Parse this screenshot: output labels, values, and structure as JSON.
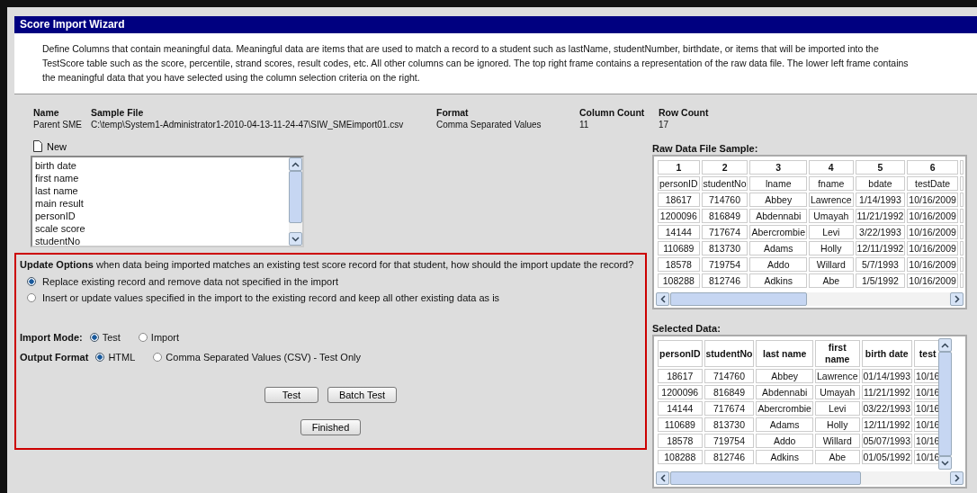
{
  "window": {
    "title": "Score Import Wizard"
  },
  "description": "Define Columns that contain meaningful data. Meaningful data are items that are used to match a record to a student such as lastName, studentNumber, birthdate, or items that will be imported into the TestScore table such as the score, percentile, strand scores, result codes, etc. All other columns can be ignored. The top right frame contains a representation of the raw data file. The lower left frame contains the meaningful data that you have selected using the column selection criteria on the right.",
  "file_info": [
    {
      "label": "Name",
      "value": "Parent SME"
    },
    {
      "label": "Sample File",
      "value": "C:\\temp\\System1-Administrator1-2010-04-13-11-24-47\\SIW_SMEimport01.csv"
    },
    {
      "label": "Format",
      "value": "Comma Separated Values"
    },
    {
      "label": "Column Count",
      "value": "11"
    },
    {
      "label": "Row Count",
      "value": "17"
    }
  ],
  "new_button": {
    "label": "New"
  },
  "field_list": {
    "items": [
      "birth date",
      "first name",
      "last name",
      "main result",
      "personID",
      "scale score",
      "studentNo"
    ]
  },
  "update_options": {
    "label": "Update Options",
    "question": "when data being imported matches an existing test score record for that student, how should the import update the record?",
    "options": [
      {
        "label": "Replace existing record and remove data not specified in the import",
        "selected": true
      },
      {
        "label": "Insert or update values specified in the import to the existing record and keep all other existing data as is",
        "selected": false
      }
    ]
  },
  "import_mode": {
    "label": "Import Mode:",
    "options": [
      {
        "label": "Test",
        "selected": true
      },
      {
        "label": "Import",
        "selected": false
      }
    ]
  },
  "output_format": {
    "label": "Output Format",
    "options": [
      {
        "label": "HTML",
        "selected": true
      },
      {
        "label": "Comma Separated Values (CSV) - Test Only",
        "selected": false
      }
    ]
  },
  "button_rows": [
    [
      "Test",
      "Batch Test"
    ],
    [
      "Finished"
    ]
  ],
  "raw_sample": {
    "title": "Raw Data File Sample:",
    "column_numbers": [
      "1",
      "2",
      "3",
      "4",
      "5",
      "6"
    ],
    "column_names": [
      "personID",
      "studentNo",
      "lname",
      "fname",
      "bdate",
      "testDate"
    ],
    "rows": [
      [
        "18617",
        "714760",
        "Abbey",
        "Lawrence",
        "1/14/1993",
        "10/16/2009"
      ],
      [
        "1200096",
        "816849",
        "Abdennabi",
        "Umayah",
        "11/21/1992",
        "10/16/2009"
      ],
      [
        "14144",
        "717674",
        "Abercrombie",
        "Levi",
        "3/22/1993",
        "10/16/2009"
      ],
      [
        "110689",
        "813730",
        "Adams",
        "Holly",
        "12/11/1992",
        "10/16/2009"
      ],
      [
        "18578",
        "719754",
        "Addo",
        "Willard",
        "5/7/1993",
        "10/16/2009"
      ],
      [
        "108288",
        "812746",
        "Adkins",
        "Abe",
        "1/5/1992",
        "10/16/2009"
      ]
    ]
  },
  "selected_data": {
    "title": "Selected Data:",
    "columns": [
      "personID",
      "studentNo",
      "last name",
      "first name",
      "birth date",
      "test"
    ],
    "rows": [
      [
        "18617",
        "714760",
        "Abbey",
        "Lawrence",
        "01/14/1993",
        "10/16"
      ],
      [
        "1200096",
        "816849",
        "Abdennabi",
        "Umayah",
        "11/21/1992",
        "10/16"
      ],
      [
        "14144",
        "717674",
        "Abercrombie",
        "Levi",
        "03/22/1993",
        "10/16"
      ],
      [
        "110689",
        "813730",
        "Adams",
        "Holly",
        "12/11/1992",
        "10/16"
      ],
      [
        "18578",
        "719754",
        "Addo",
        "Willard",
        "05/07/1993",
        "10/16"
      ],
      [
        "108288",
        "812746",
        "Adkins",
        "Abe",
        "01/05/1992",
        "10/16"
      ]
    ]
  }
}
